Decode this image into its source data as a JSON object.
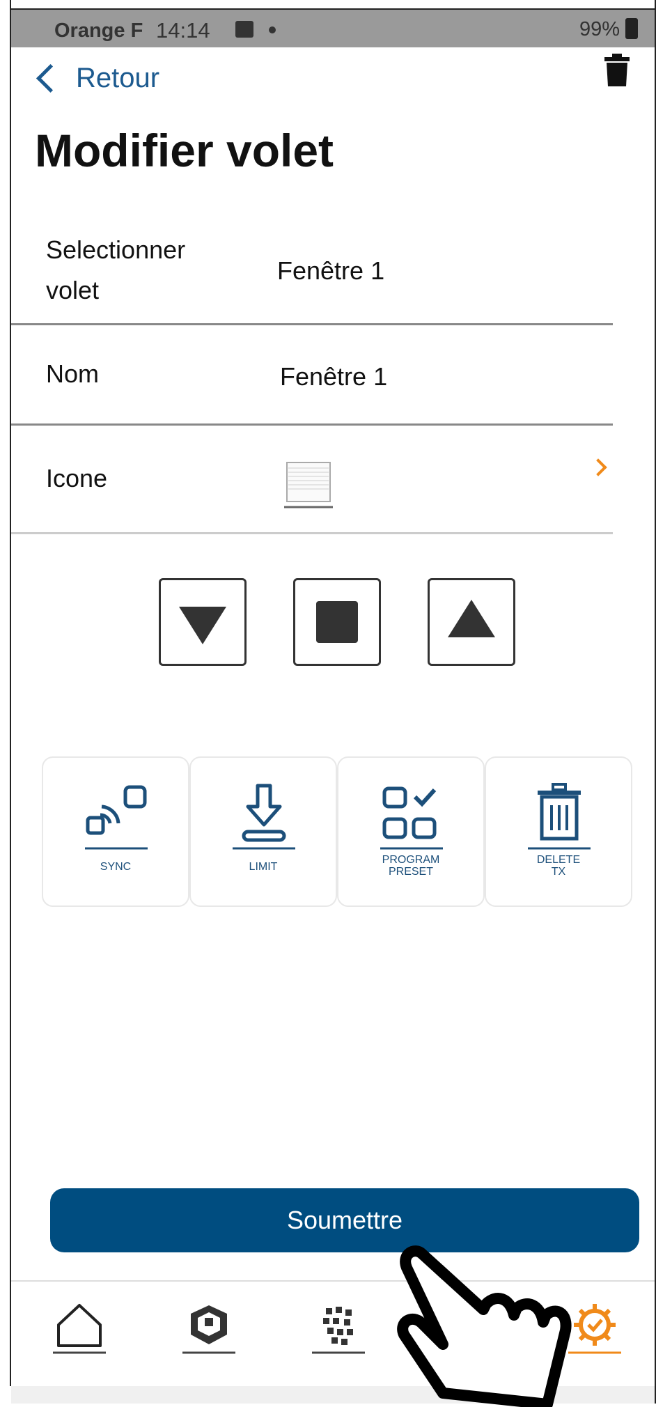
{
  "status_bar": {
    "carrier": "Orange F",
    "time": "14:14",
    "battery": "99%"
  },
  "header": {
    "back_label": "Retour",
    "title": "Modifier volet"
  },
  "form": {
    "select_label": "Selectionner volet",
    "select_label_line1": "Selectionner",
    "select_label_line2": "volet",
    "select_value": "Fenêtre 1",
    "name_label": "Nom",
    "name_value": "Fenêtre 1",
    "icon_label": "Icone"
  },
  "controls": [
    "down-button",
    "stop-button",
    "up-button"
  ],
  "actions": [
    {
      "label": "SYNC"
    },
    {
      "label": "LIMIT"
    },
    {
      "label_line1": "PROGRAM",
      "label_line2": "PRESET"
    },
    {
      "label_line1": "DELETE",
      "label_line2": "TX"
    }
  ],
  "submit_label": "Soumettre",
  "bottom_nav": [
    {
      "icon": "home-icon",
      "active": false
    },
    {
      "icon": "cube-icon",
      "active": false
    },
    {
      "icon": "grid-icon",
      "active": false
    },
    {
      "icon": "list-icon",
      "active": false
    },
    {
      "icon": "settings-gear-icon",
      "active": true
    }
  ],
  "colors": {
    "accent_blue": "#004d80",
    "link_blue": "#1c5a8f",
    "orange": "#f08a1a",
    "icon_navy": "#1c4f7a"
  }
}
